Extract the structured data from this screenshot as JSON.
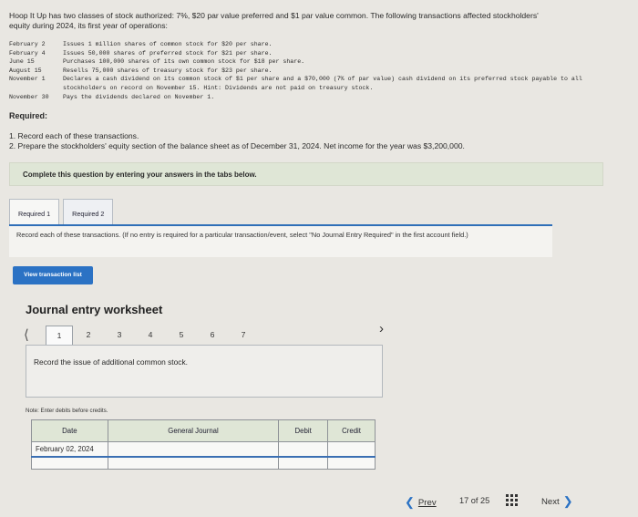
{
  "problem": {
    "intro": "Hoop It Up has two classes of stock authorized: 7%, $20 par value preferred and $1 par value common. The following transactions affected stockholders' equity during 2024, its first year of operations:",
    "transactions": [
      {
        "date": "February 2",
        "text": "Issues 1 million shares of common stock for $20 per share."
      },
      {
        "date": "February 4",
        "text": "Issues 50,000 shares of preferred stock for $21 per share."
      },
      {
        "date": "June 15",
        "text": "Purchases 100,000 shares of its own common stock for $18 per share."
      },
      {
        "date": "August 15",
        "text": "Resells 75,000 shares of treasury stock for $23 per share."
      },
      {
        "date": "November 1",
        "text": "Declares a cash dividend on its common stock of $1 per share and a $70,000 (7% of par value) cash dividend on its preferred stock payable to all stockholders on record on November 15. Hint: Dividends are not paid on treasury stock."
      },
      {
        "date": "November 30",
        "text": "Pays the dividends declared on November 1."
      }
    ],
    "required_title": "Required:",
    "required_items": [
      "1. Record each of these transactions.",
      "2. Prepare the stockholders' equity section of the balance sheet as of December 31, 2024. Net income for the year was $3,200,000."
    ]
  },
  "complete_bar": "Complete this question by entering your answers in the tabs below.",
  "tabs": [
    {
      "label": "Required 1",
      "active": true
    },
    {
      "label": "Required 2",
      "active": false
    }
  ],
  "instructions": "Record each of these transactions. (If no entry is required for a particular transaction/event, select \"No Journal Entry Required\" in the first account field.)",
  "view_button": "View transaction list",
  "worksheet": {
    "title": "Journal entry worksheet",
    "pages": [
      "1",
      "2",
      "3",
      "4",
      "5",
      "6",
      "7"
    ],
    "active_page": "1",
    "record_text": "Record the issue of additional common stock.",
    "note": "Note: Enter debits before credits.",
    "table_headers": {
      "date": "Date",
      "journal": "General Journal",
      "debit": "Debit",
      "credit": "Credit"
    },
    "entry_date": "February 02, 2024"
  },
  "navigation": {
    "prev": "Prev",
    "counter": "17 of 25",
    "next": "Next"
  }
}
